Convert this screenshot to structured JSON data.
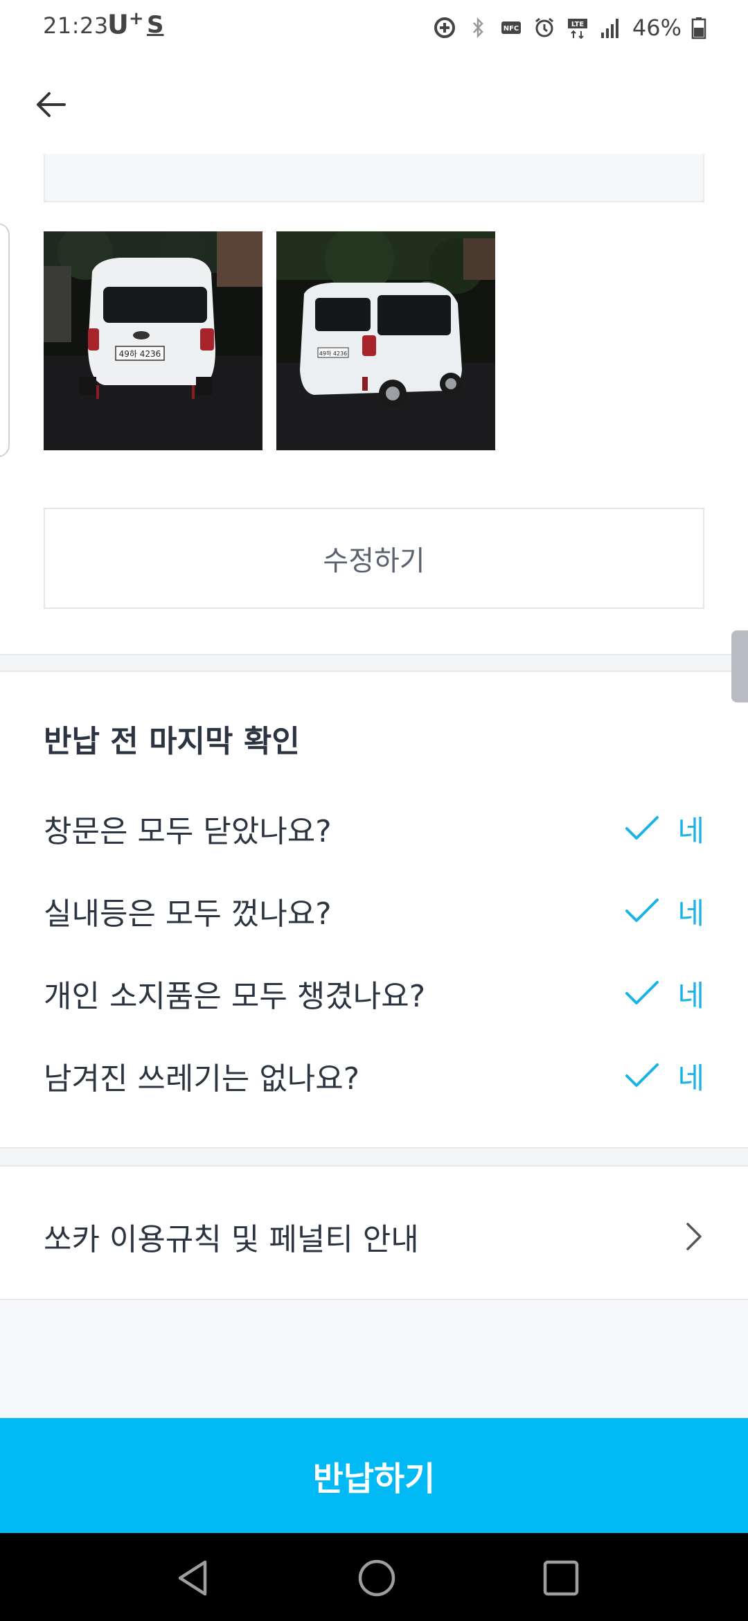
{
  "status_bar": {
    "time": "21:23",
    "carrier": "U",
    "carrier_sup": "+",
    "s_icon_text": "S",
    "battery_percent": "46%",
    "icons": [
      "data-saver-icon",
      "bluetooth-icon",
      "nfc-icon",
      "alarm-icon",
      "lte-icon",
      "signal-icon",
      "battery-icon"
    ]
  },
  "header": {
    "back_icon": "back-arrow-icon"
  },
  "photos": [
    {
      "plate_text": "49하 4236"
    },
    {
      "plate_text": "49하 4236"
    }
  ],
  "edit_button": {
    "label": "수정하기"
  },
  "checklist": {
    "title": "반납 전 마지막 확인",
    "items": [
      {
        "question": "창문은 모두 닫았나요?",
        "answer": "네"
      },
      {
        "question": "실내등은 모두 껐나요?",
        "answer": "네"
      },
      {
        "question": "개인 소지품은 모두 챙겼나요?",
        "answer": "네"
      },
      {
        "question": "남겨진 쓰레기는 없나요?",
        "answer": "네"
      }
    ]
  },
  "rules_link": {
    "label": "쏘카 이용규칙 및 페널티 안내"
  },
  "return_button": {
    "label": "반납하기"
  },
  "colors": {
    "accent": "#00b9f5",
    "check": "#1ab3e8",
    "text": "#2b3440",
    "nav_bar": "#000000"
  },
  "nav_icons": [
    "back-triangle-icon",
    "home-circle-icon",
    "recents-square-icon"
  ]
}
